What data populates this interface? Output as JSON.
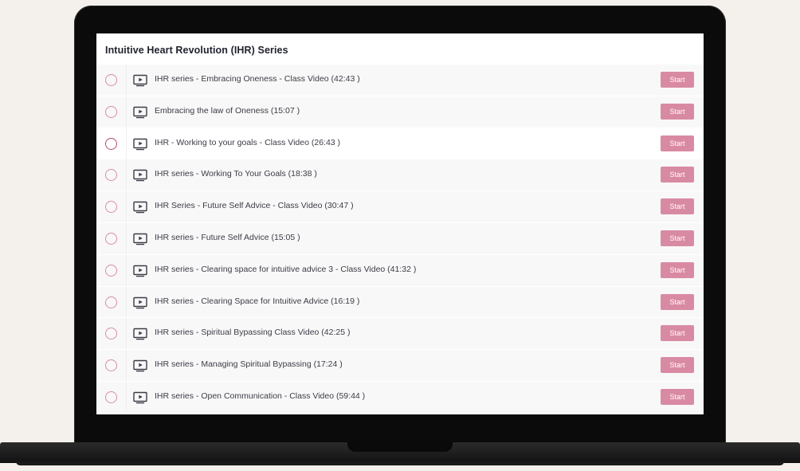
{
  "course": {
    "title": "Intuitive Heart Revolution (IHR) Series",
    "lessons": [
      {
        "title": "IHR series - Embracing Oneness - Class Video (42:43 )",
        "action": "Start",
        "icon": "video-play-icon",
        "active": false
      },
      {
        "title": "Embracing the law of Oneness (15:07 )",
        "action": "Start",
        "icon": "video-play-icon",
        "active": false
      },
      {
        "title": "IHR - Working to your goals - Class Video (26:43 )",
        "action": "Start",
        "icon": "video-play-icon",
        "active": true
      },
      {
        "title": "IHR series - Working To Your Goals (18:38 )",
        "action": "Start",
        "icon": "video-play-icon",
        "active": false
      },
      {
        "title": "IHR Series - Future Self Advice - Class Video (30:47 )",
        "action": "Start",
        "icon": "video-play-icon",
        "active": false
      },
      {
        "title": "IHR series - Future Self Advice (15:05 )",
        "action": "Start",
        "icon": "video-play-icon",
        "active": false
      },
      {
        "title": "IHR series - Clearing space for intuitive advice 3 - Class Video (41:32 )",
        "action": "Start",
        "icon": "video-play-icon",
        "active": false
      },
      {
        "title": "IHR series - Clearing Space for Intuitive Advice (16:19 )",
        "action": "Start",
        "icon": "video-play-icon",
        "active": false
      },
      {
        "title": "IHR series - Spiritual Bypassing Class Video (42:25 )",
        "action": "Start",
        "icon": "video-play-icon",
        "active": false
      },
      {
        "title": "IHR series - Managing Spiritual Bypassing (17:24 )",
        "action": "Start",
        "icon": "video-play-icon",
        "active": false
      },
      {
        "title": "IHR series - Open Communication - Class Video (59:44 )",
        "action": "Start",
        "icon": "video-play-icon",
        "active": false
      }
    ]
  },
  "colors": {
    "accent": "#d98aa3",
    "circle": "#d98e9e",
    "circle_active": "#b94a64",
    "text": "#3b3d46",
    "background": "#f4f1ec",
    "laptop": "#0b0b0b"
  }
}
